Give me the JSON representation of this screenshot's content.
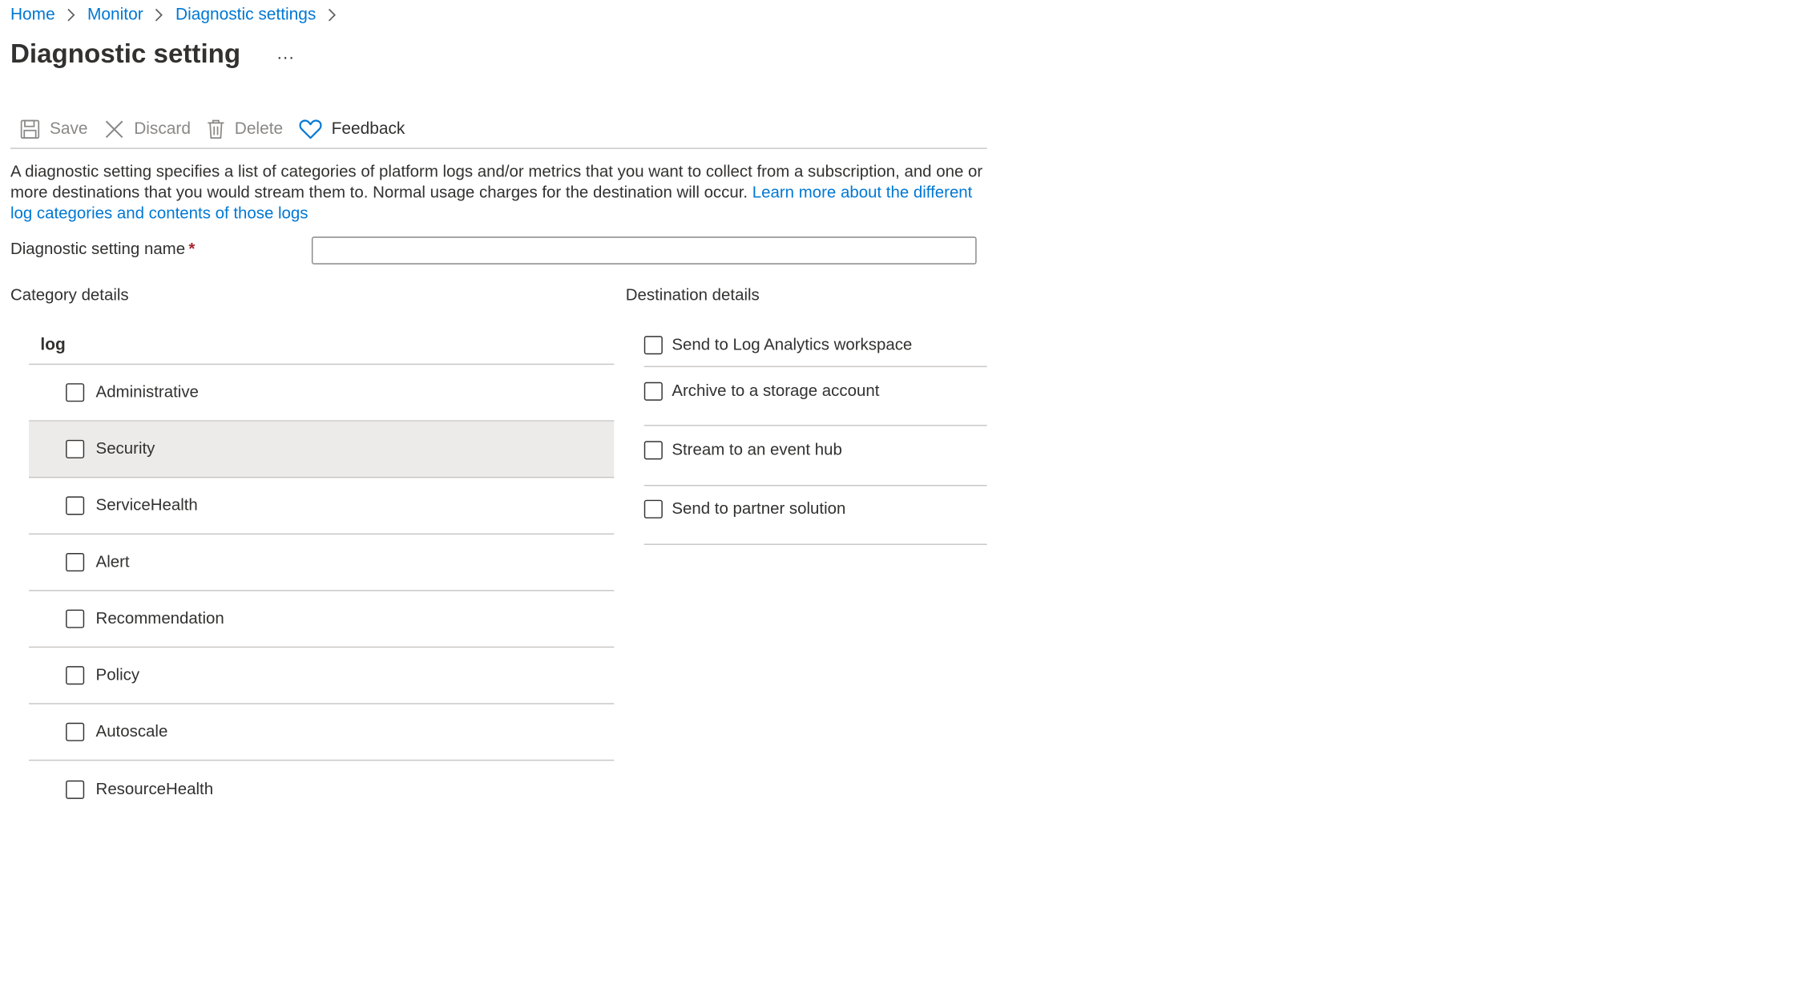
{
  "breadcrumb": {
    "items": [
      "Home",
      "Monitor",
      "Diagnostic settings"
    ]
  },
  "page": {
    "title": "Diagnostic setting",
    "more": "..."
  },
  "toolbar": {
    "save_label": "Save",
    "discard_label": "Discard",
    "delete_label": "Delete",
    "feedback_label": "Feedback"
  },
  "description": {
    "text": "A diagnostic setting specifies a list of categories of platform logs and/or metrics that you want to collect from a subscription, and one or more destinations that you would stream them to. Normal usage charges for the destination will occur. ",
    "link": "Learn more about the different log categories and contents of those logs"
  },
  "name_field": {
    "label": "Diagnostic setting name",
    "required_mark": "*",
    "value": ""
  },
  "category_details": {
    "title": "Category details",
    "group_label": "log",
    "items": [
      {
        "label": "Administrative",
        "checked": false
      },
      {
        "label": "Security",
        "checked": false
      },
      {
        "label": "ServiceHealth",
        "checked": false
      },
      {
        "label": "Alert",
        "checked": false
      },
      {
        "label": "Recommendation",
        "checked": false
      },
      {
        "label": "Policy",
        "checked": false
      },
      {
        "label": "Autoscale",
        "checked": false
      },
      {
        "label": "ResourceHealth",
        "checked": false
      }
    ]
  },
  "destination_details": {
    "title": "Destination details",
    "items": [
      {
        "label": "Send to Log Analytics workspace",
        "checked": false
      },
      {
        "label": "Archive to a storage account",
        "checked": false
      },
      {
        "label": "Stream to an event hub",
        "checked": false
      },
      {
        "label": "Send to partner solution",
        "checked": false
      }
    ]
  },
  "colors": {
    "link": "#0078d4",
    "text": "#323130",
    "disabled": "#8a8886",
    "divider": "#c8c6c4",
    "row_hover": "#edebe9",
    "required": "#a4262c"
  }
}
